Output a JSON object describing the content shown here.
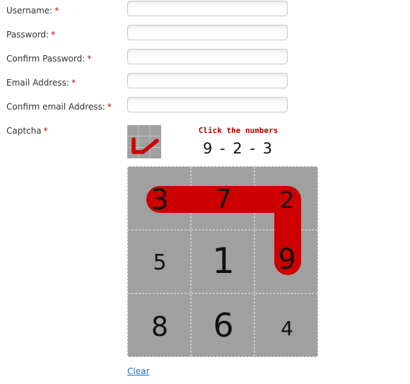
{
  "form": {
    "fields": [
      {
        "label": "Username:",
        "required": "*",
        "value": "",
        "placeholder": ""
      },
      {
        "label": "Password:",
        "required": "*",
        "value": "",
        "placeholder": ""
      },
      {
        "label": "Confirm Password:",
        "required": "*",
        "value": "",
        "placeholder": ""
      },
      {
        "label": "Email Address:",
        "required": "*",
        "value": "",
        "placeholder": ""
      },
      {
        "label": "Confirm email Address:",
        "required": "*",
        "value": "",
        "placeholder": ""
      }
    ],
    "captcha": {
      "label": "Captcha",
      "required": "*",
      "heading": "Click the numbers",
      "sequence": "9 - 2 - 3",
      "grid": [
        [
          "3",
          "7",
          "2"
        ],
        [
          "5",
          "1",
          "9"
        ],
        [
          "8",
          "6",
          "4"
        ]
      ],
      "path_color": "#cc0000",
      "grid_color": "#a0a0a0"
    },
    "clear_label": "Clear"
  }
}
